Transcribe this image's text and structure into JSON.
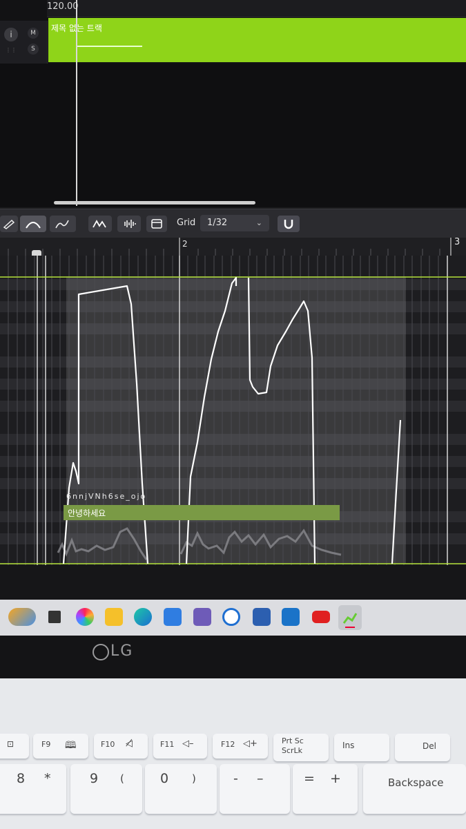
{
  "app": {
    "tempo": "120.00",
    "track": {
      "title": "제목 없는 트랙",
      "info_label": "i",
      "mute_label": "M",
      "solo_label": "S"
    }
  },
  "toolbar": {
    "grid_label": "Grid",
    "grid_value": "1/32",
    "tools": [
      "pencil-tool",
      "curve-tool",
      "freehand-tool",
      "pitch-curve-tool",
      "waveform-tool",
      "piano-roll-tool",
      "snap-magnet-tool"
    ]
  },
  "editor": {
    "ruler": {
      "bar2": "2",
      "bar3": "3"
    },
    "note": {
      "name": "6nnjVNh6se_ojo",
      "lyric": "안녕하세요"
    }
  },
  "taskbar": {
    "icons": [
      "weather-icon",
      "task-view-icon",
      "copilot-icon",
      "file-explorer-icon",
      "edge-icon",
      "store-icon",
      "app-icon",
      "settings-icon",
      "remote-desktop-icon",
      "outlook-icon",
      "youtube-icon",
      "daw-icon"
    ]
  },
  "laptop": {
    "brand": "LG"
  },
  "keyboard": {
    "fn_row": [
      {
        "label": "F9"
      },
      {
        "label": "F10"
      },
      {
        "label": "F11"
      },
      {
        "label": "F12"
      },
      {
        "label": "Prt Sc",
        "sub": "ScrLk"
      },
      {
        "label": "Ins"
      },
      {
        "label": "Del"
      }
    ],
    "num_row": [
      {
        "top": "*",
        "main": "8"
      },
      {
        "top": "(",
        "main": "9"
      },
      {
        "top": ")",
        "main": "0"
      },
      {
        "top": "–",
        "main": "-"
      },
      {
        "top": "+",
        "main": "="
      },
      {
        "main": "Backspace"
      }
    ]
  },
  "colors": {
    "accent": "#8fd419",
    "lyric": "#7a9a45",
    "curve": "#ffffff"
  }
}
